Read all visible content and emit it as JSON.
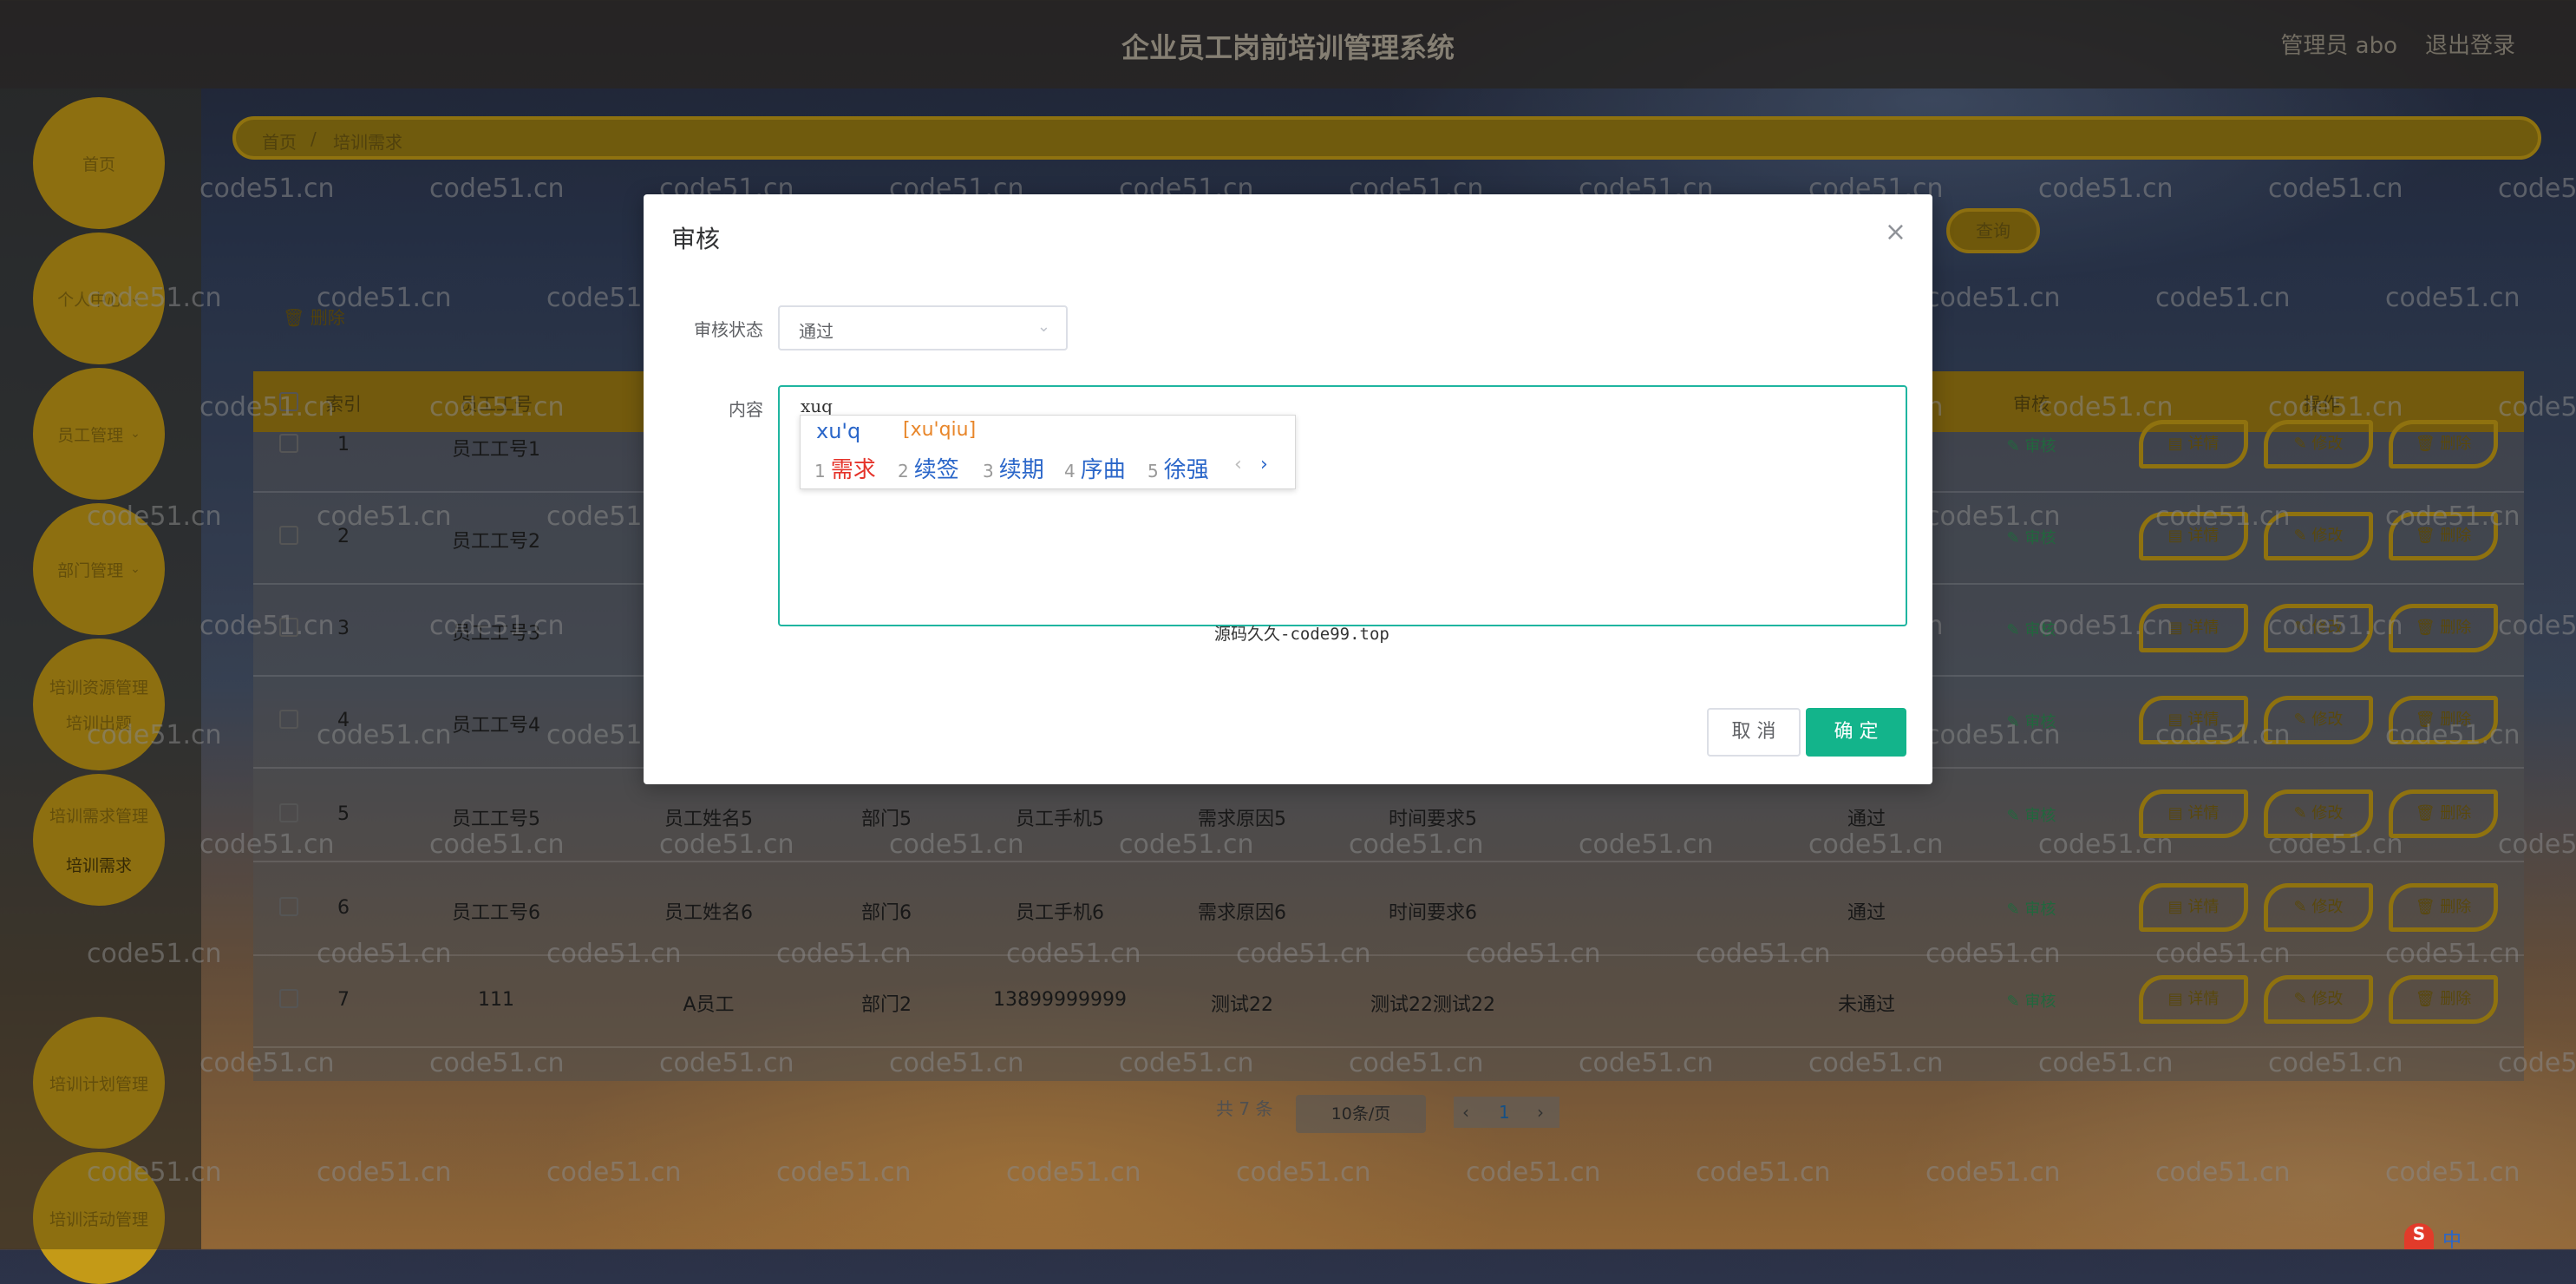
{
  "header": {
    "title": "企业员工岗前培训管理系统",
    "admin": "管理员 abo",
    "logout": "退出登录"
  },
  "sidebar": {
    "items": [
      {
        "label": "首页"
      },
      {
        "label": "个人中心"
      },
      {
        "label": "员工管理"
      },
      {
        "label": "部门管理"
      },
      {
        "label": "培训资源管理"
      },
      {
        "label": "培训出题"
      },
      {
        "label": "培训需求管理"
      },
      {
        "label": "培训需求"
      },
      {
        "label": "培训计划管理"
      },
      {
        "label": "培训活动管理"
      }
    ]
  },
  "breadcrumb": {
    "home": "首页",
    "sep": "/",
    "current": "培训需求"
  },
  "toolbar": {
    "search": "查询",
    "delete": "删除"
  },
  "table": {
    "headers": [
      "索引",
      "员工工号",
      "审核",
      "操作"
    ],
    "rows": [
      {
        "idx": "1",
        "no": "员工工号1",
        "name": "",
        "dept": "",
        "phone": "",
        "reason": "",
        "time": "",
        "status": ""
      },
      {
        "idx": "2",
        "no": "员工工号2",
        "name": "",
        "dept": "",
        "phone": "",
        "reason": "",
        "time": "",
        "status": ""
      },
      {
        "idx": "3",
        "no": "员工工号3",
        "name": "",
        "dept": "",
        "phone": "",
        "reason": "",
        "time": "",
        "status": ""
      },
      {
        "idx": "4",
        "no": "员工工号4",
        "name": "",
        "dept": "",
        "phone": "",
        "reason": "",
        "time": "",
        "status": ""
      },
      {
        "idx": "5",
        "no": "员工工号5",
        "name": "员工姓名5",
        "dept": "部门5",
        "phone": "员工手机5",
        "reason": "需求原因5",
        "time": "时间要求5",
        "status": "通过"
      },
      {
        "idx": "6",
        "no": "员工工号6",
        "name": "员工姓名6",
        "dept": "部门6",
        "phone": "员工手机6",
        "reason": "需求原因6",
        "time": "时间要求6",
        "status": "通过"
      },
      {
        "idx": "7",
        "no": "111",
        "name": "A员工",
        "dept": "部门2",
        "phone": "13899999999",
        "reason": "测试22",
        "time": "测试22测试22",
        "status": "未通过"
      }
    ],
    "audit": "审核",
    "ops": {
      "detail": "详情",
      "edit": "修改",
      "del": "删除"
    }
  },
  "pager": {
    "total": "共 7 条",
    "size": "10条/页",
    "prev": "‹",
    "page": "1",
    "next": "›"
  },
  "modal": {
    "title": "审核",
    "close": "×",
    "status_label": "审核状态",
    "status_value": "通过",
    "content_label": "内容",
    "content_value": "xuq",
    "source_note": "源码久久-code99.top",
    "cancel": "取 消",
    "ok": "确 定"
  },
  "ime": {
    "pinyin": "xu'q",
    "hint": "[xu'qiu]",
    "candidates": [
      {
        "n": "1",
        "t": "需求"
      },
      {
        "n": "2",
        "t": "续签"
      },
      {
        "n": "3",
        "t": "续期"
      },
      {
        "n": "4",
        "t": "序曲"
      },
      {
        "n": "5",
        "t": "徐强"
      }
    ],
    "prev": "‹",
    "next": "›"
  },
  "watermark": "code51.cn",
  "tray": {
    "s": "S",
    "zh": "中"
  },
  "colors": {
    "accent": "#c49a17",
    "primary_green": "#13b48b",
    "audit_green": "#2f8f55"
  }
}
